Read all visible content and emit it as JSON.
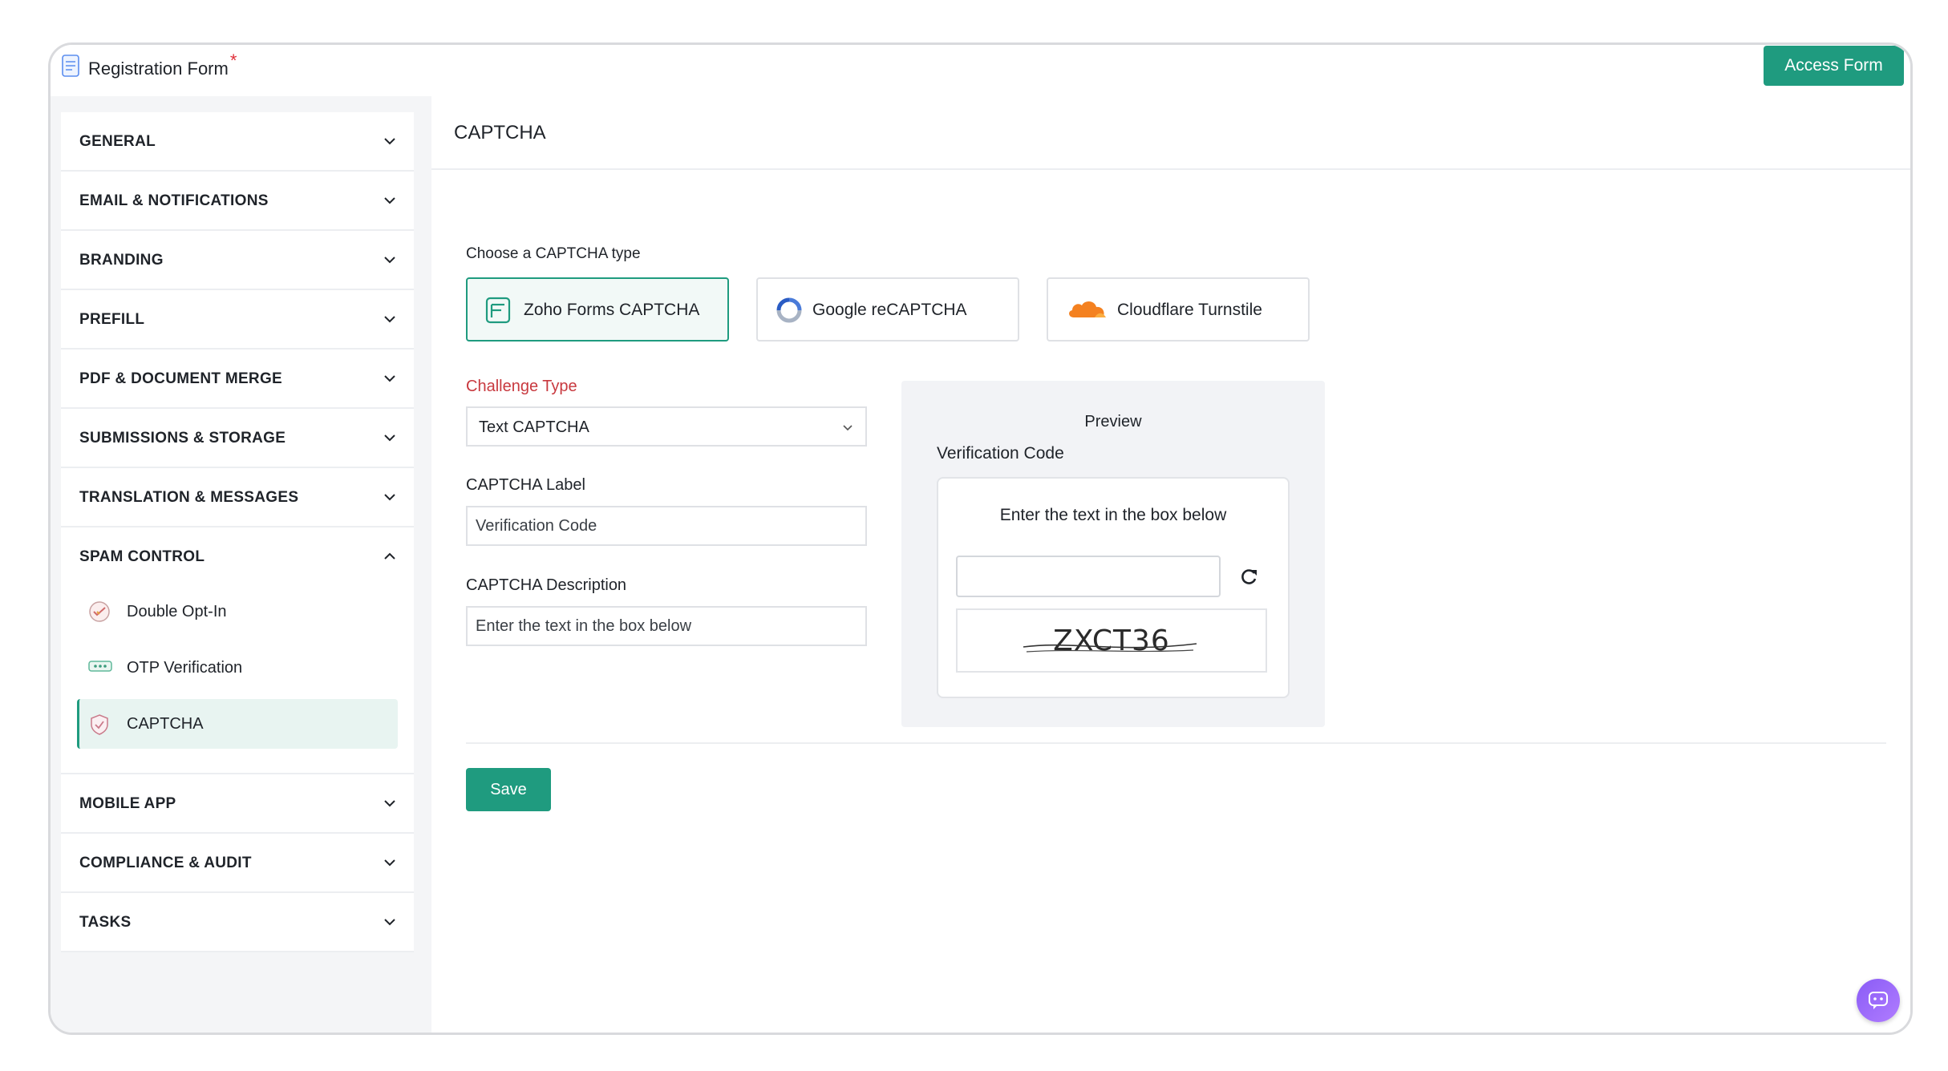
{
  "header": {
    "form_title": "Registration Form",
    "required_mark": "*",
    "access_button": "Access Form"
  },
  "sidebar": {
    "items_top": [
      {
        "label": "GENERAL"
      },
      {
        "label": "EMAIL & NOTIFICATIONS"
      },
      {
        "label": "BRANDING"
      },
      {
        "label": "PREFILL"
      },
      {
        "label": "PDF & DOCUMENT MERGE"
      },
      {
        "label": "SUBMISSIONS & STORAGE"
      },
      {
        "label": "TRANSLATION & MESSAGES"
      }
    ],
    "expanded": {
      "label": "SPAM CONTROL",
      "children": [
        {
          "label": "Double Opt-In",
          "icon": "double-optin-icon"
        },
        {
          "label": "OTP Verification",
          "icon": "otp-icon"
        },
        {
          "label": "CAPTCHA",
          "icon": "captcha-shield-icon",
          "active": true
        }
      ]
    },
    "items_bottom": [
      {
        "label": "MOBILE APP"
      },
      {
        "label": "COMPLIANCE & AUDIT"
      },
      {
        "label": "TASKS"
      }
    ]
  },
  "main": {
    "section_title": "CAPTCHA",
    "choose_label": "Choose a CAPTCHA type",
    "captcha_types": [
      {
        "label": "Zoho Forms CAPTCHA",
        "selected": true
      },
      {
        "label": "Google reCAPTCHA",
        "selected": false
      },
      {
        "label": "Cloudflare Turnstile",
        "selected": false
      }
    ],
    "challenge_type_label": "Challenge Type",
    "challenge_type_value": "Text CAPTCHA",
    "captcha_label_label": "CAPTCHA Label",
    "captcha_label_value": "Verification Code",
    "captcha_description_label": "CAPTCHA Description",
    "captcha_description_value": "Enter the text in the box below",
    "preview": {
      "title": "Preview",
      "field_label": "Verification Code",
      "description": "Enter the text in the box below",
      "captcha_text": "ZXCT36"
    },
    "save_button": "Save"
  },
  "colors": {
    "accent": "#1f9b7f",
    "required_red": "#e0303a",
    "label_red": "#c8393f",
    "chat_purple": "#8a5cf6"
  }
}
